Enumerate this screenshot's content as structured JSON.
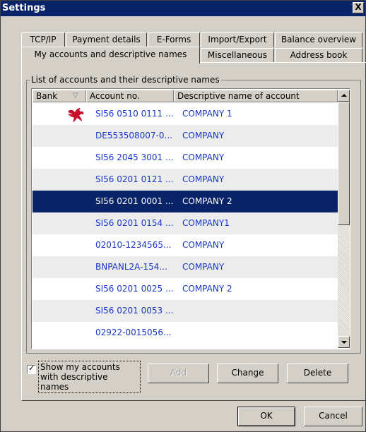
{
  "window": {
    "title": "Settings",
    "close_glyph": "X"
  },
  "tabs_row1": [
    {
      "label": "TCP/IP"
    },
    {
      "label": "Payment details"
    },
    {
      "label": "E-Forms"
    },
    {
      "label": "Import/Export"
    },
    {
      "label": "Balance overview"
    }
  ],
  "tabs_row2": [
    {
      "label": "My accounts and descriptive names",
      "active": true
    },
    {
      "label": "Miscellaneous"
    },
    {
      "label": "Address book"
    }
  ],
  "group": {
    "legend": "List of accounts and their descriptive names"
  },
  "columns": {
    "bank": "Bank",
    "account": "Account no.",
    "description": "Descriptive name of account"
  },
  "rows": [
    {
      "account": "SI56 0510 0111 ...",
      "description": "COMPANY 1",
      "bank_icon": "bank-logo-icon"
    },
    {
      "account": "DE553508007-0...",
      "description": "COMPANY"
    },
    {
      "account": "SI56 2045 3001 ...",
      "description": "COMPANY"
    },
    {
      "account": "SI56 0201 0121 ...",
      "description": "COMPANY"
    },
    {
      "account": "SI56 0201 0001 ...",
      "description": "COMPANY 2",
      "selected": true
    },
    {
      "account": "SI56 0201 0154 ...",
      "description": "COMPANY1"
    },
    {
      "account": "02010-1234565...",
      "description": "COMPANY"
    },
    {
      "account": "BNPANL2A-154...",
      "description": "COMPANY"
    },
    {
      "account": "SI56 0201 0025 ...",
      "description": "COMPANY 2"
    },
    {
      "account": "SI56 0201 0053 ...",
      "description": ""
    },
    {
      "account": "02922-0015056...",
      "description": ""
    }
  ],
  "options": {
    "show_descriptive_label": "Show my accounts with descriptive names",
    "show_descriptive_checked": true
  },
  "buttons": {
    "add": "Add",
    "change": "Change",
    "delete": "Delete",
    "ok": "OK",
    "cancel": "Cancel"
  },
  "colors": {
    "selection": "#0a246a",
    "link_text": "#1a36c8",
    "alt_row": "#ececec",
    "face": "#d4d0c8"
  }
}
